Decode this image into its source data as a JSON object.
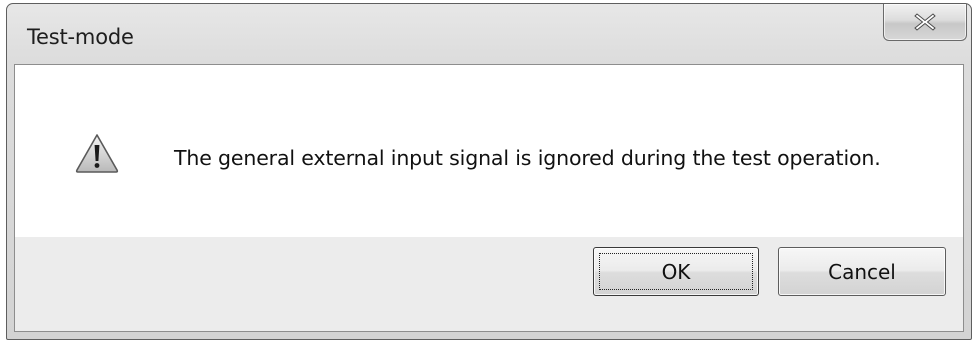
{
  "window": {
    "title": "Test-mode"
  },
  "title_bar": {
    "close_icon": "close-x-icon"
  },
  "message": {
    "icon": "warning-triangle-icon",
    "text": "The general external input signal is ignored during the test operation."
  },
  "buttons": {
    "ok_label": "OK",
    "cancel_label": "Cancel"
  }
}
